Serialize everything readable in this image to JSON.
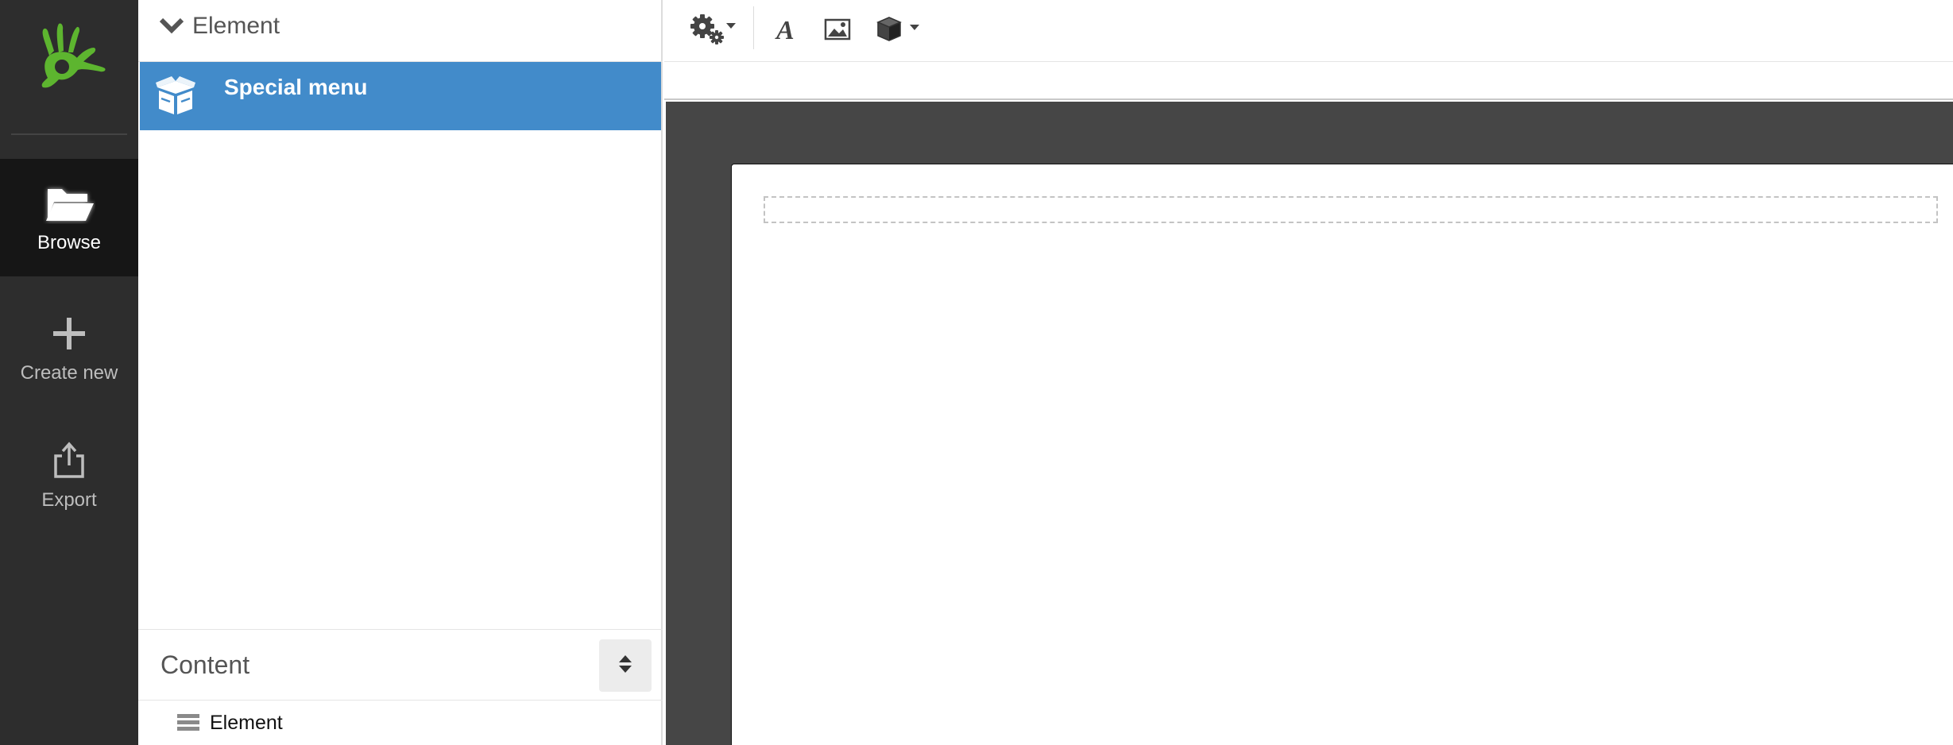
{
  "nav": {
    "logo_icon": "green-hand-logo",
    "items": [
      {
        "label": "Browse",
        "icon": "open-folder-icon",
        "active": true
      },
      {
        "label": "Create new",
        "icon": "plus-icon",
        "active": false
      },
      {
        "label": "Export",
        "icon": "export-icon",
        "active": false
      }
    ]
  },
  "tree": {
    "header": {
      "title": "Element",
      "icon": "chevron-down-icon"
    },
    "selected_item": {
      "label": "Special menu",
      "icon": "open-box-icon"
    },
    "content": {
      "title": "Content",
      "sort_icon": "sort-icon",
      "items": [
        {
          "label": "Element",
          "icon": "list-icon"
        }
      ]
    }
  },
  "toolbar": {
    "buttons": [
      {
        "name": "settings",
        "icon": "gears-icon",
        "dropdown": true
      },
      {
        "name": "text",
        "icon": "font-icon",
        "dropdown": false
      },
      {
        "name": "image",
        "icon": "image-icon",
        "dropdown": false
      },
      {
        "name": "component",
        "icon": "cube-icon",
        "dropdown": true
      }
    ]
  },
  "colors": {
    "nav_bg": "#2d2d2d",
    "nav_active_bg": "#161616",
    "selection_blue": "#428bca",
    "logo_green": "#5db52f",
    "stage_bg": "#464646"
  }
}
